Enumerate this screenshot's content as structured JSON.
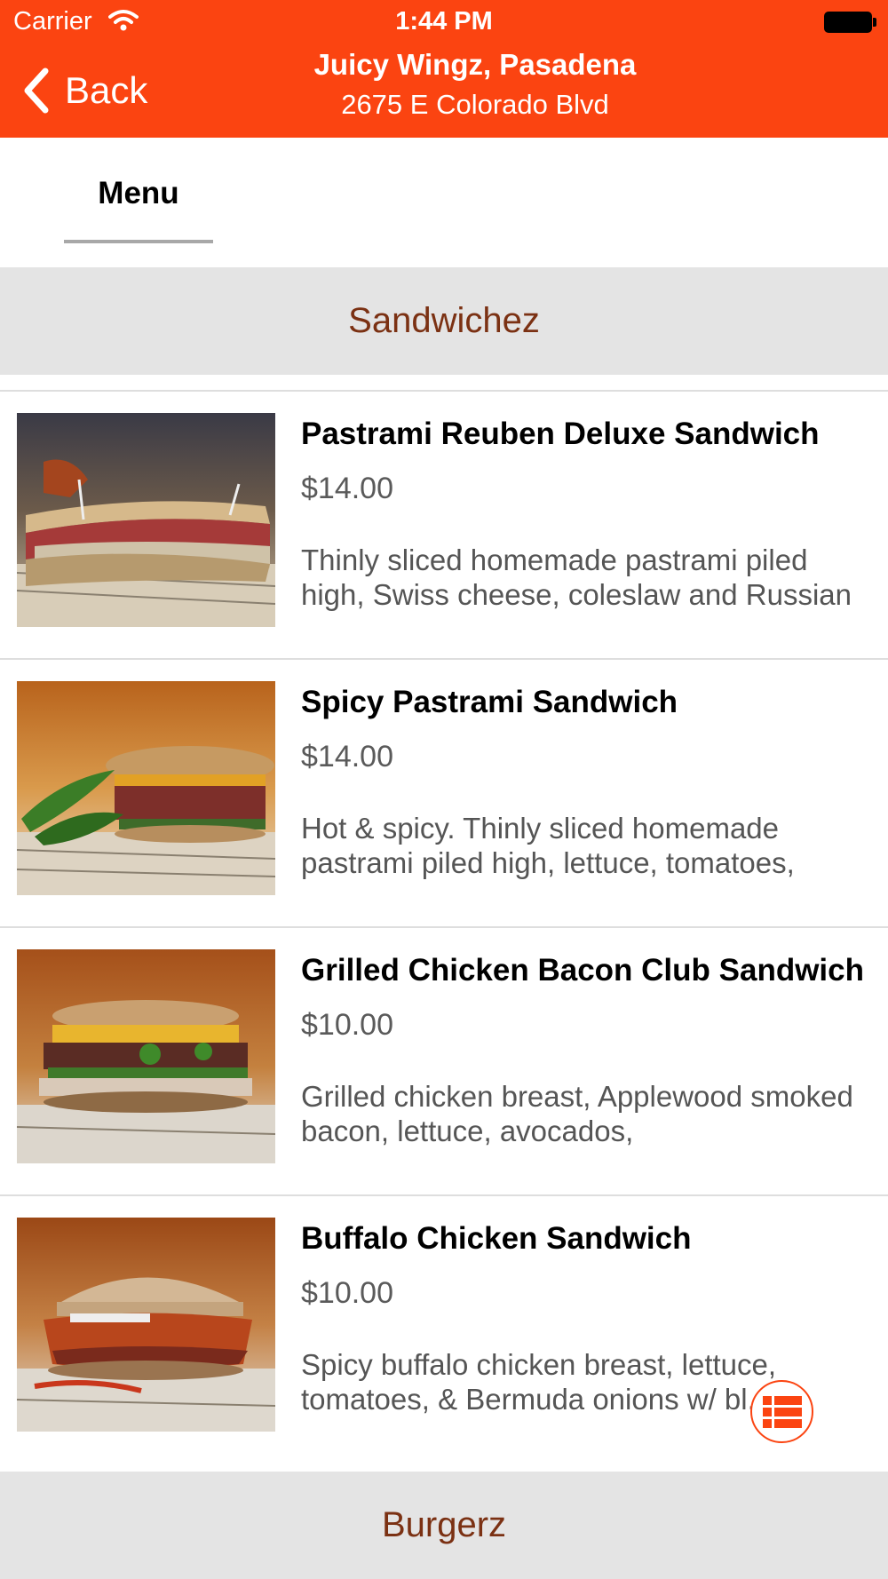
{
  "status_bar": {
    "carrier": "Carrier",
    "time": "1:44 PM",
    "icons": [
      "wifi-icon",
      "battery-icon"
    ]
  },
  "nav": {
    "back_label": "Back",
    "back_icon": "chevron-left-icon",
    "title": "Juicy Wingz, Pasadena",
    "subtitle": "2675 E Colorado Blvd"
  },
  "tabs": [
    {
      "label": "Menu",
      "active": true
    }
  ],
  "sections": [
    {
      "title": "Sandwichez"
    },
    {
      "title": "Burgerz"
    }
  ],
  "items": [
    {
      "name": "Pastrami Reuben Deluxe Sandwich",
      "price": "$14.00",
      "description": "Thinly sliced homemade pastrami piled high, Swiss cheese, coleslaw and Russian"
    },
    {
      "name": "Spicy Pastrami Sandwich",
      "price": "$14.00",
      "description": "Hot & spicy. Thinly sliced homemade pastrami piled high, lettuce, tomatoes,"
    },
    {
      "name": "Grilled Chicken Bacon Club Sandwich",
      "price": "$10.00",
      "description": "Grilled chicken breast, Applewood smoked bacon, lettuce, avocados,"
    },
    {
      "name": "Buffalo Chicken Sandwich",
      "price": "$10.00",
      "description": "Spicy buffalo chicken breast, lettuce, tomatoes, & Bermuda onions w/ bl..."
    }
  ],
  "floating_button": {
    "icon": "list-menu-icon"
  },
  "colors": {
    "brand": "#fb4411",
    "section_bg": "#e4e4e4",
    "section_text": "#7b3113",
    "price_text": "#5a5a5a"
  }
}
